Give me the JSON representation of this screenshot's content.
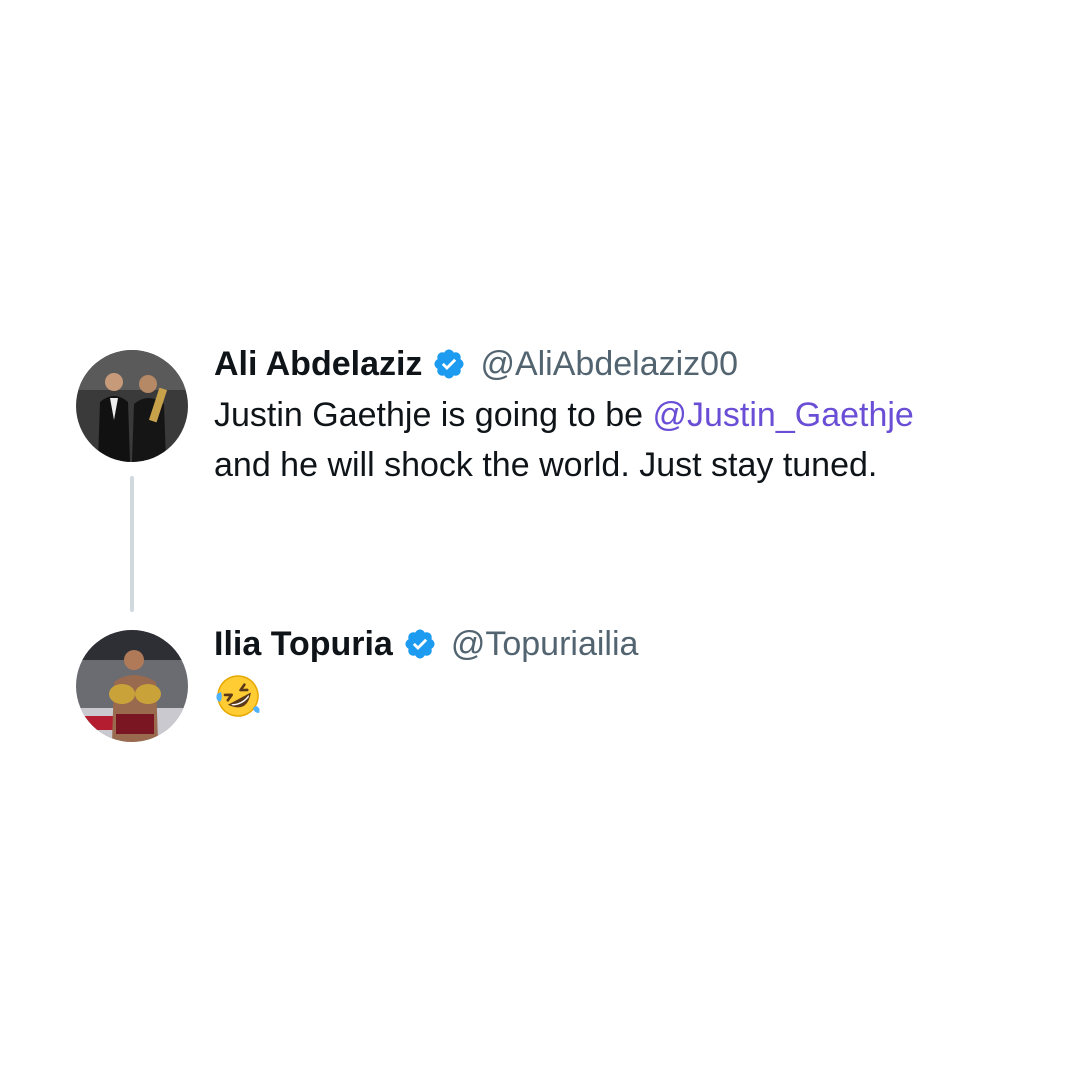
{
  "tweets": [
    {
      "display_name": "Ali Abdelaziz",
      "handle": "@AliAbdelaziz00",
      "verified": true,
      "avatar_icon": "avatar-photo",
      "text_before": "Justin Gaethje is going to be ",
      "mention": "@Justin_Gaethje",
      "text_line2": "and he will shock the world. Just stay tuned."
    },
    {
      "display_name": "Ilia Topuria",
      "handle": "@Topuriailia",
      "verified": true,
      "avatar_icon": "avatar-photo",
      "text": "🤣",
      "emoji_icon": "rolling-on-floor-laughing-emoji"
    }
  ],
  "colors": {
    "verified_badge": "#1d9bf0",
    "mention_link": "#6a4fd6",
    "handle_gray": "#536471",
    "thread_line": "#cfd9de"
  }
}
